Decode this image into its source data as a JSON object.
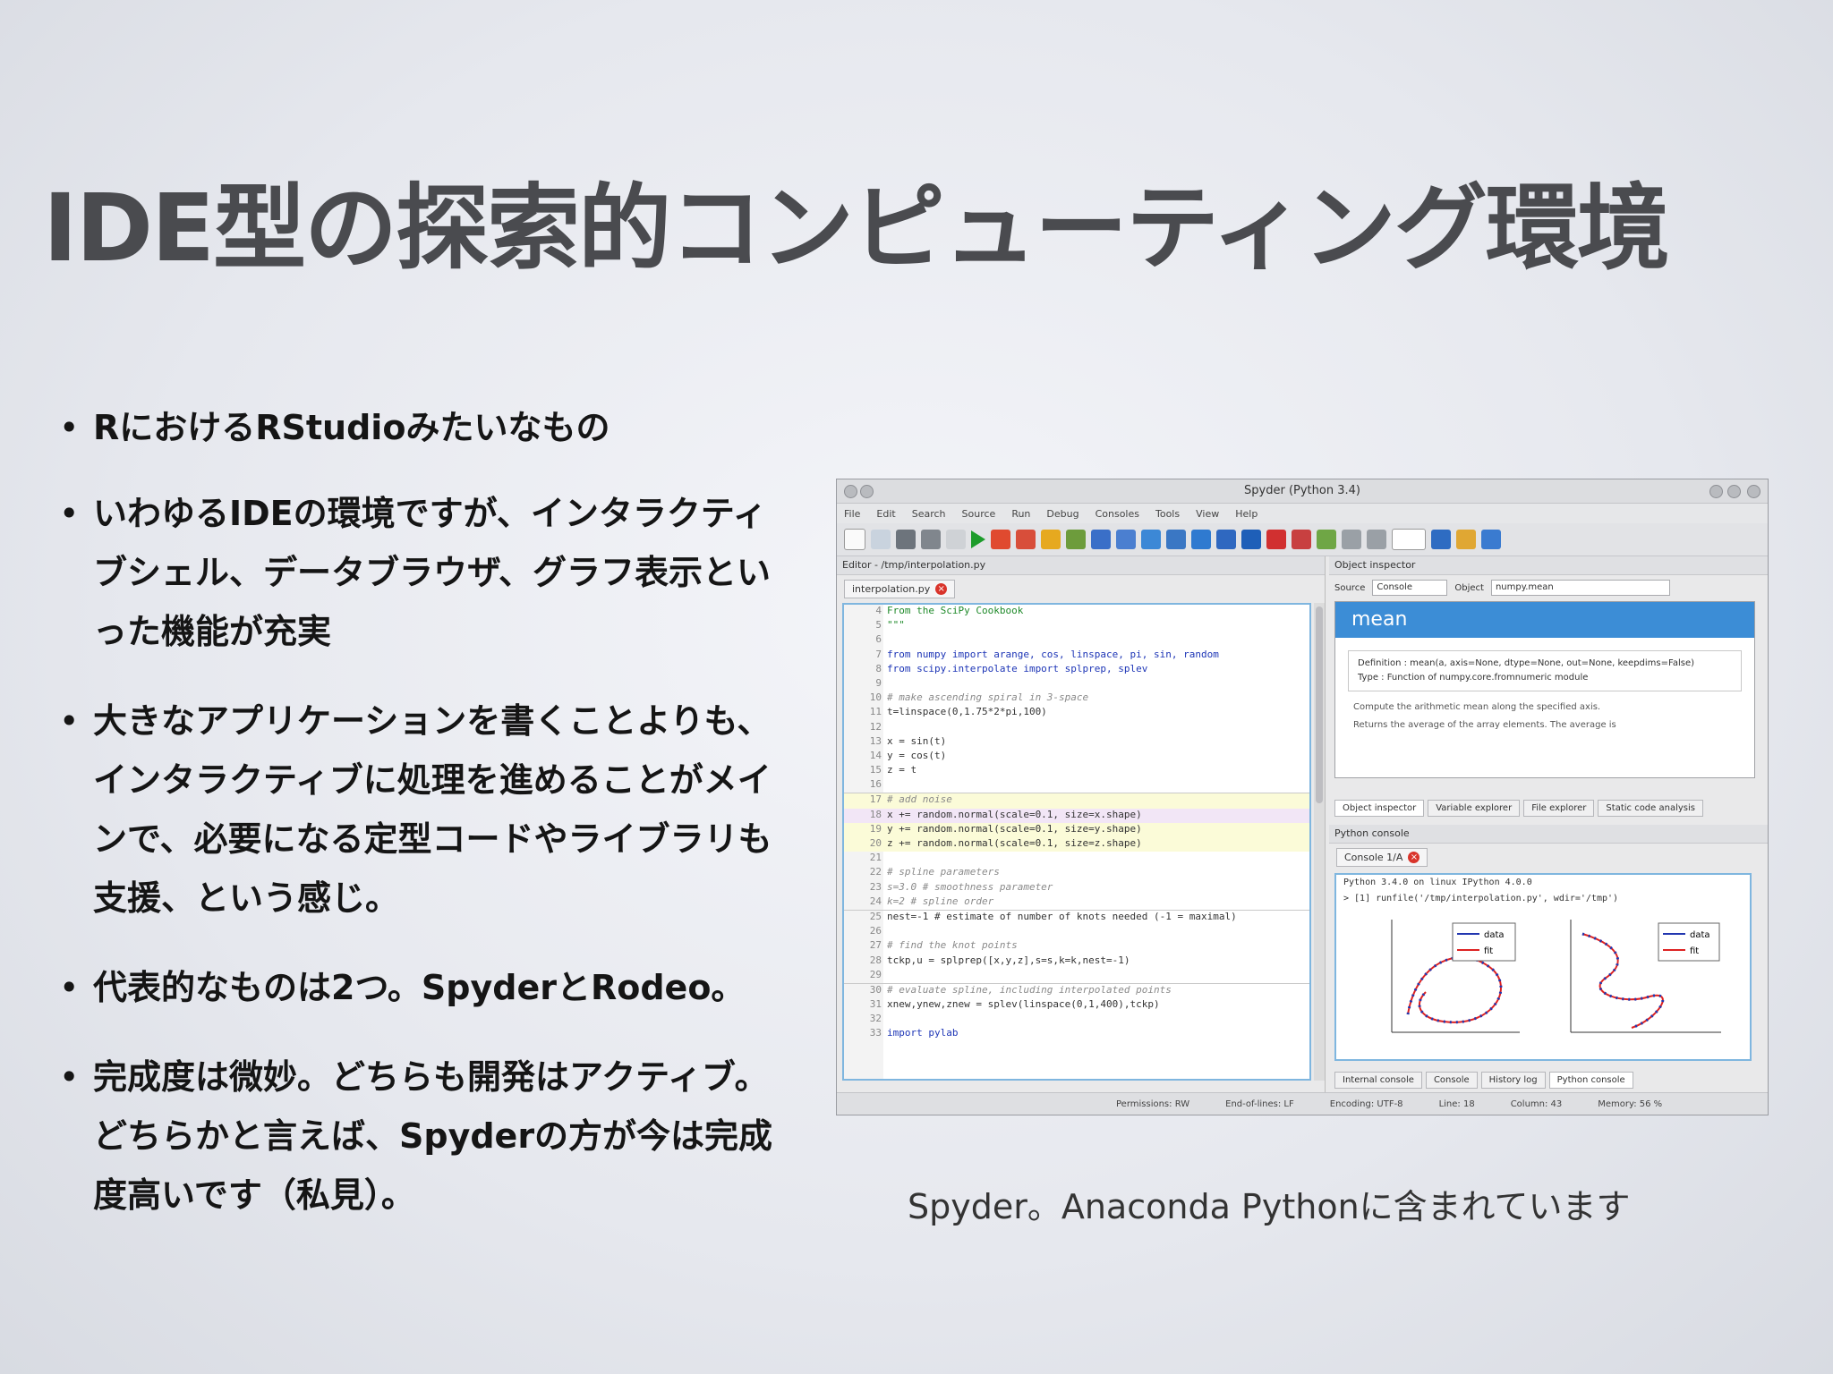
{
  "slide": {
    "title": "IDE型の探索的コンピューティング環境",
    "bullets": [
      "RにおけるRStudioみたいなもの",
      "いわゆるIDEの環境ですが、インタラクティブシェル、データブラウザ、グラフ表示といった機能が充実",
      "大きなアプリケーションを書くことよりも、インタラクティブに処理を進めることがメインで、必要になる定型コードやライブラリも支援、という感じ。",
      "代表的なものは2つ。SpyderとRodeo。",
      "完成度は微妙。どちらも開発はアクティブ。どちらかと言えば、Spyderの方が今は完成度高いです（私見）。"
    ],
    "caption": "Spyder。Anaconda Pythonに含まれています"
  },
  "spyder": {
    "window_title": "Spyder (Python 3.4)",
    "menu": [
      "File",
      "Edit",
      "Search",
      "Source",
      "Run",
      "Debug",
      "Consoles",
      "Tools",
      "View",
      "Help"
    ],
    "editor_header": "Editor - /tmp/interpolation.py",
    "editor_tab": "interpolation.py",
    "code_lines": [
      {
        "n": "4",
        "t": "From the SciPy Cookbook",
        "c": "gr"
      },
      {
        "n": "5",
        "t": "\"\"\"",
        "c": "gr"
      },
      {
        "n": "6",
        "t": "",
        "c": ""
      },
      {
        "n": "7",
        "t": "from numpy import arange, cos, linspace, pi, sin, random",
        "c": "kw"
      },
      {
        "n": "8",
        "t": "from scipy.interpolate import splprep, splev",
        "c": "kw"
      },
      {
        "n": "9",
        "t": "",
        "c": ""
      },
      {
        "n": "10",
        "t": "# make ascending spiral in 3-space",
        "c": "cm"
      },
      {
        "n": "11",
        "t": "t=linspace(0,1.75*2*pi,100)",
        "c": ""
      },
      {
        "n": "12",
        "t": "",
        "c": ""
      },
      {
        "n": "13",
        "t": "x = sin(t)",
        "c": ""
      },
      {
        "n": "14",
        "t": "y = cos(t)",
        "c": ""
      },
      {
        "n": "15",
        "t": "z = t",
        "c": ""
      },
      {
        "n": "16",
        "t": "",
        "c": ""
      },
      {
        "n": "17",
        "t": "# add noise",
        "c": "cm"
      },
      {
        "n": "18",
        "t": "x += random.normal(scale=0.1, size=x.shape)",
        "c": ""
      },
      {
        "n": "19",
        "t": "y += random.normal(scale=0.1, size=y.shape)",
        "c": ""
      },
      {
        "n": "20",
        "t": "z += random.normal(scale=0.1, size=z.shape)",
        "c": ""
      },
      {
        "n": "21",
        "t": "",
        "c": ""
      },
      {
        "n": "22",
        "t": "# spline parameters",
        "c": "cm"
      },
      {
        "n": "23",
        "t": "s=3.0 # smoothness parameter",
        "c": "cm"
      },
      {
        "n": "24",
        "t": "k=2 # spline order",
        "c": "cm"
      },
      {
        "n": "25",
        "t": "nest=-1 # estimate of number of knots needed (-1 = maximal)",
        "c": ""
      },
      {
        "n": "26",
        "t": "",
        "c": ""
      },
      {
        "n": "27",
        "t": "# find the knot points",
        "c": "cm"
      },
      {
        "n": "28",
        "t": "tckp,u = splprep([x,y,z],s=s,k=k,nest=-1)",
        "c": ""
      },
      {
        "n": "29",
        "t": "",
        "c": ""
      },
      {
        "n": "30",
        "t": "# evaluate spline, including interpolated points",
        "c": "cm"
      },
      {
        "n": "31",
        "t": "xnew,ynew,znew = splev(linspace(0,1,400),tckp)",
        "c": ""
      },
      {
        "n": "32",
        "t": "",
        "c": ""
      },
      {
        "n": "33",
        "t": "import pylab",
        "c": "kw"
      }
    ],
    "inspector": {
      "header": "Object inspector",
      "source_label": "Source",
      "source_value": "Console",
      "object_label": "Object",
      "object_value": "numpy.mean",
      "help_title": "mean",
      "definition": "Definition : mean(a, axis=None, dtype=None, out=None, keepdims=False)",
      "type": "Type : Function of numpy.core.fromnumeric module",
      "desc1": "Compute the arithmetic mean along the specified axis.",
      "desc2": "Returns the average of the array elements. The average is"
    },
    "inspector_tabs": [
      "Object inspector",
      "Variable explorer",
      "File explorer",
      "Static code analysis"
    ],
    "console": {
      "header": "Python console",
      "tab": "Console 1/A",
      "line1": "Python 3.4.0 on linux     IPython 4.0.0",
      "line2": "> [1]  runfile('/tmp/interpolation.py', wdir='/tmp')",
      "legend_data": "data",
      "legend_fit": "fit"
    },
    "console_tabs": [
      "Internal console",
      "Console",
      "History log",
      "Python console"
    ],
    "status": [
      "Permissions: RW",
      "End-of-lines: LF",
      "Encoding: UTF-8",
      "Line: 18",
      "Column: 43",
      "Memory: 56 %"
    ],
    "colors": {
      "accent": "#3c8dd6",
      "close": "#d9342b"
    }
  }
}
